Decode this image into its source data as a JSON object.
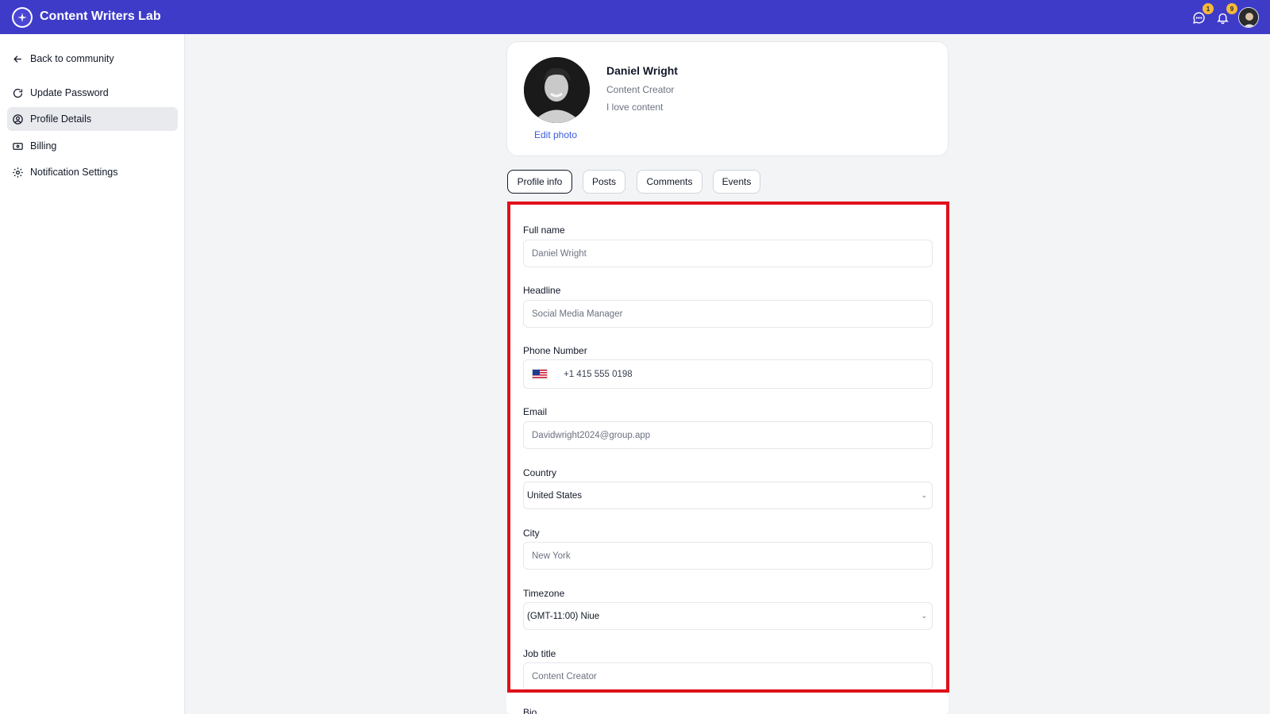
{
  "app": {
    "title": "Content Writers Lab",
    "brand_color": "#3f3bc9",
    "chat_badge": "1",
    "bell_badge": "9"
  },
  "sidebar": {
    "items": [
      {
        "label": "Back to community",
        "icon": "arrow-left-icon"
      },
      {
        "label": "Update Password",
        "icon": "refresh-icon"
      },
      {
        "label": "Profile Details",
        "icon": "user-circle-icon",
        "active": true
      },
      {
        "label": "Billing",
        "icon": "card-icon"
      },
      {
        "label": "Notification Settings",
        "icon": "gear-icon"
      }
    ]
  },
  "profile": {
    "name": "Daniel Wright",
    "role": "Content Creator",
    "bio": "I love content",
    "edit_photo": "Edit photo"
  },
  "tabs": [
    {
      "label": "Profile info",
      "active": true
    },
    {
      "label": "Posts"
    },
    {
      "label": "Comments"
    },
    {
      "label": "Events"
    }
  ],
  "form": {
    "full_name": {
      "label": "Full name",
      "value": "Daniel Wright"
    },
    "headline": {
      "label": "Headline",
      "value": "Social Media Manager"
    },
    "phone": {
      "label": "Phone Number",
      "value": "+1 415 555 0198"
    },
    "email": {
      "label": "Email",
      "value": "Davidwright2024@group.app"
    },
    "country": {
      "label": "Country",
      "value": "United States"
    },
    "city": {
      "label": "City",
      "value": "New York"
    },
    "timezone": {
      "label": "Timezone",
      "value": "(GMT-11:00) Niue"
    },
    "job_title": {
      "label": "Job title",
      "value": "Content Creator"
    },
    "bio": {
      "label": "Bio"
    }
  },
  "highlight_color": "#e0101a"
}
